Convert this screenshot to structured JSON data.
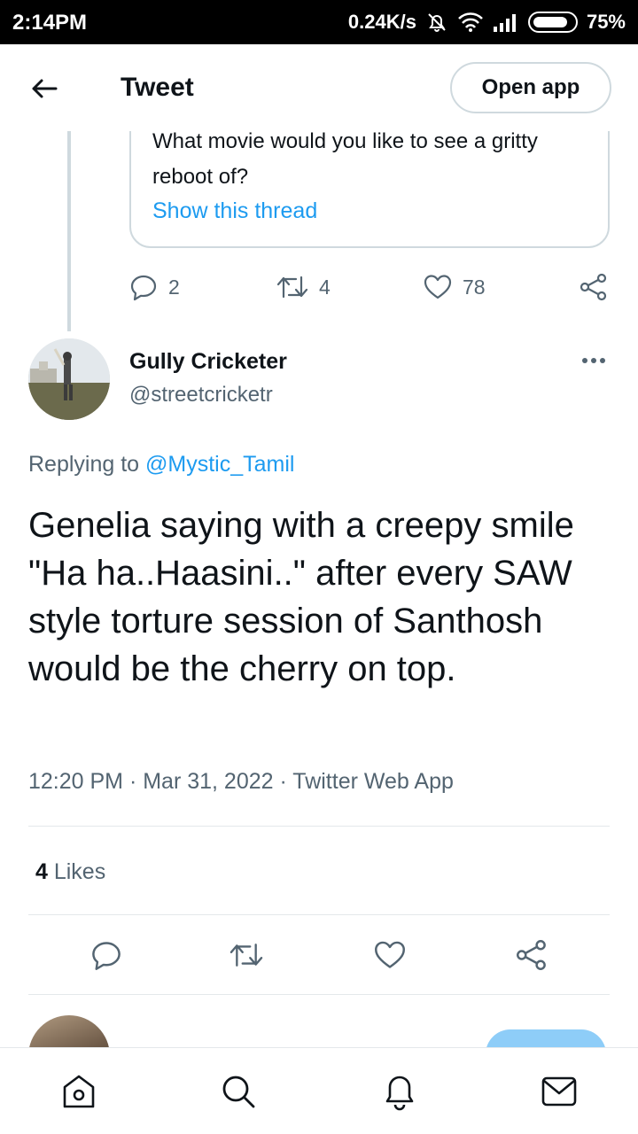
{
  "status_bar": {
    "time": "2:14PM",
    "network_speed": "0.24K/s",
    "battery": "75%",
    "icons": [
      "alarm-off-icon",
      "wifi-icon",
      "signal-icon",
      "battery-icon"
    ]
  },
  "header": {
    "title": "Tweet",
    "open_app_label": "Open app",
    "back_icon": "arrow-left-icon"
  },
  "quoted": {
    "text": "What movie would you like to see a gritty reboot of?",
    "show_thread": "Show this thread"
  },
  "parent_actions": {
    "replies": "2",
    "retweets": "4",
    "likes": "78"
  },
  "author": {
    "name": "Gully Cricketer",
    "handle": "@streetcricketr"
  },
  "replying": {
    "prefix": "Replying to ",
    "mention": "@Mystic_Tamil"
  },
  "tweet": {
    "text": "Genelia saying with a creepy smile \"Ha ha..Haasini..\" after every SAW style torture session of Santhosh would be the cherry on top.",
    "meta": "12:20 PM · Mar 31, 2022 · Twitter Web App"
  },
  "stats": {
    "likes_count": "4",
    "likes_label": " Likes"
  },
  "bottom_nav": [
    "home-icon",
    "search-icon",
    "notifications-icon",
    "messages-icon"
  ],
  "colors": {
    "accent": "#1d9bf0",
    "secondary_text": "#536471",
    "border": "#cfd9de"
  }
}
